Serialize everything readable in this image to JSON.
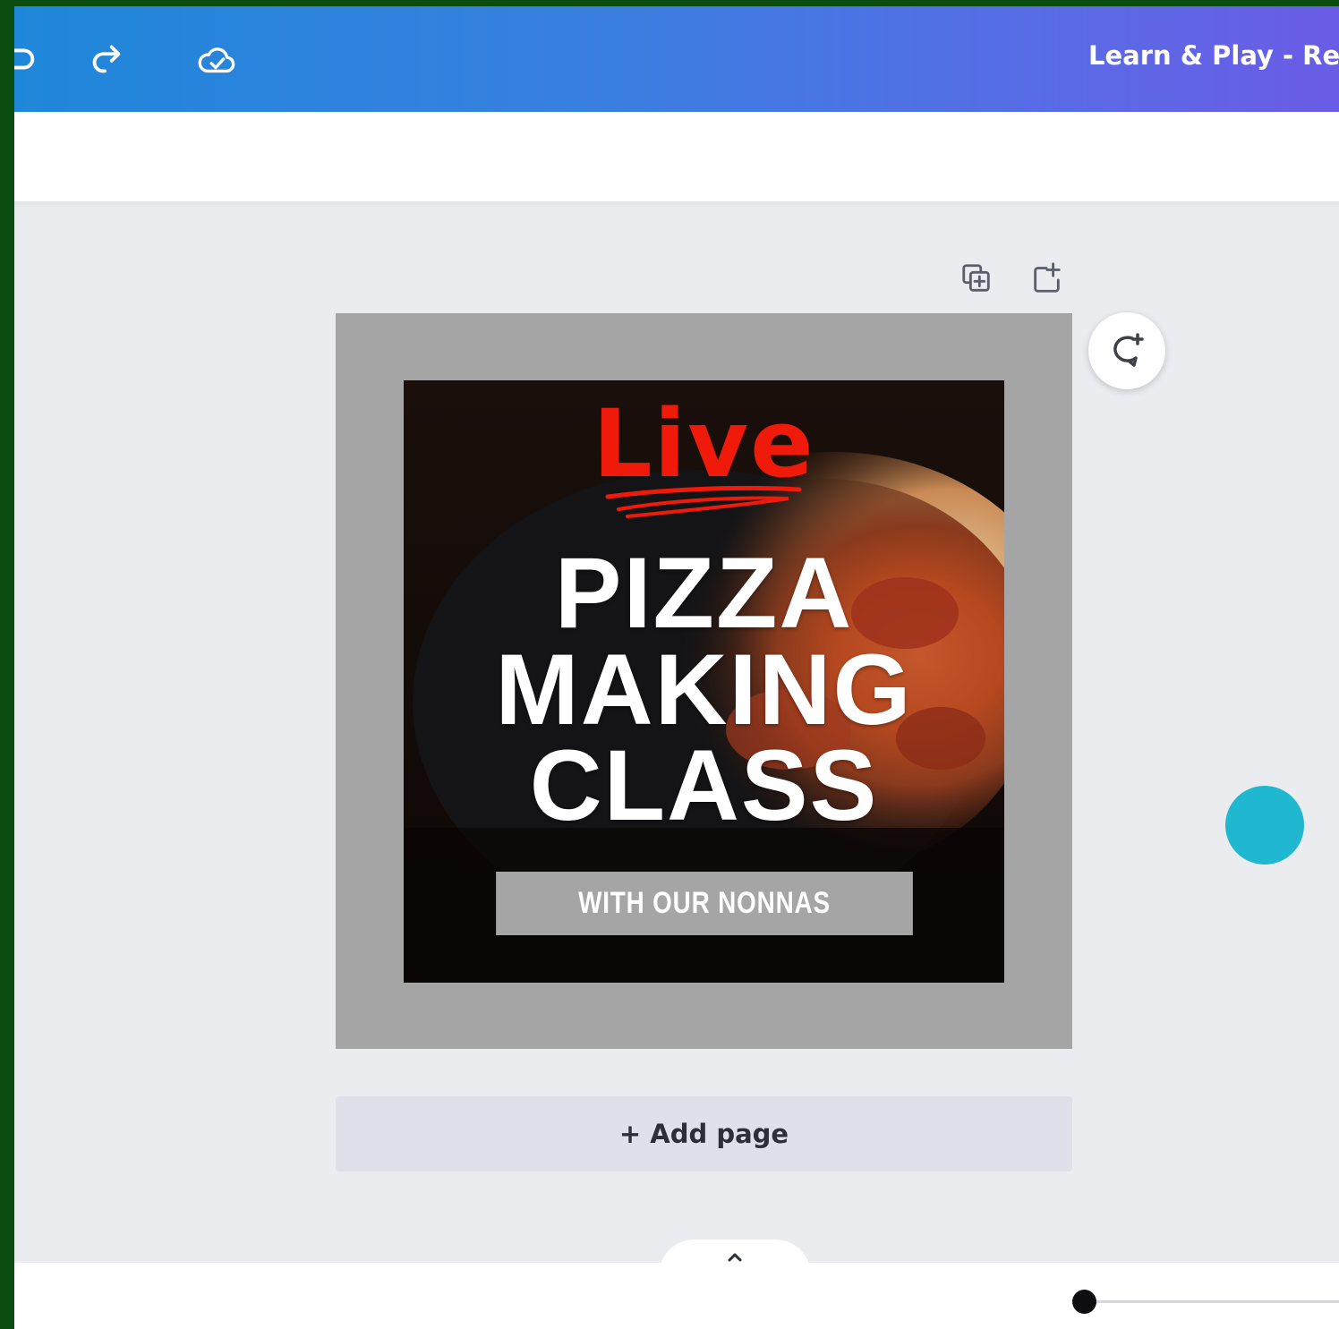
{
  "header": {
    "title": "Learn & Play - Repe",
    "undo_icon": "undo-icon",
    "redo_icon": "redo-icon",
    "save_status_icon": "cloud-check-icon"
  },
  "page_actions": {
    "duplicate_icon": "duplicate-page-icon",
    "add_icon": "add-page-icon"
  },
  "design": {
    "live": "Live",
    "headline": [
      "PIZZA",
      "MAKING",
      "CLASS"
    ],
    "subtitle": "WITH OUR NONNAS",
    "live_color": "#f01a0a"
  },
  "comment_icon": "add-comment-icon",
  "add_page_label": "+ Add page",
  "notes_toggle_icon": "chevron-up-icon",
  "colors": {
    "accent": "#20b7d0",
    "topbar_start": "#1f87d9",
    "topbar_end": "#6a5ce6"
  }
}
